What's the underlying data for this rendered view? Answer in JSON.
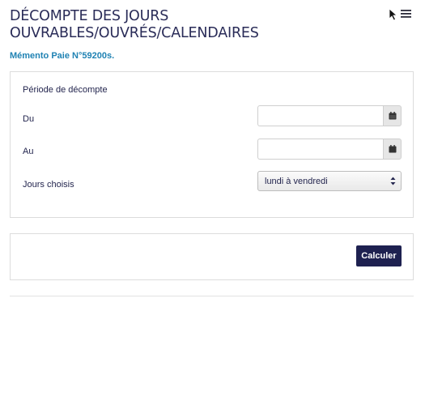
{
  "header": {
    "title_line1": "DÉCOMPTE DES JOURS",
    "title_line2": "OUVRABLES/OUVRÉS/CALENDAIRES",
    "subtitle": "Mémento Paie N°59200s.",
    "menu_icon": "hamburger-menu-icon"
  },
  "form": {
    "period_legend": "Période de décompte",
    "du_label": "Du",
    "du_value": "",
    "au_label": "Au",
    "au_value": "",
    "calendar_icon": "calendar-icon",
    "jours_label": "Jours choisis",
    "jours_selected": "lundi à vendredi"
  },
  "actions": {
    "calculate_label": "Calculer"
  },
  "colors": {
    "title": "#2a2c58",
    "subtitle": "#1f82b3",
    "button_bg": "#1e2150",
    "border": "#dcdcdc"
  }
}
